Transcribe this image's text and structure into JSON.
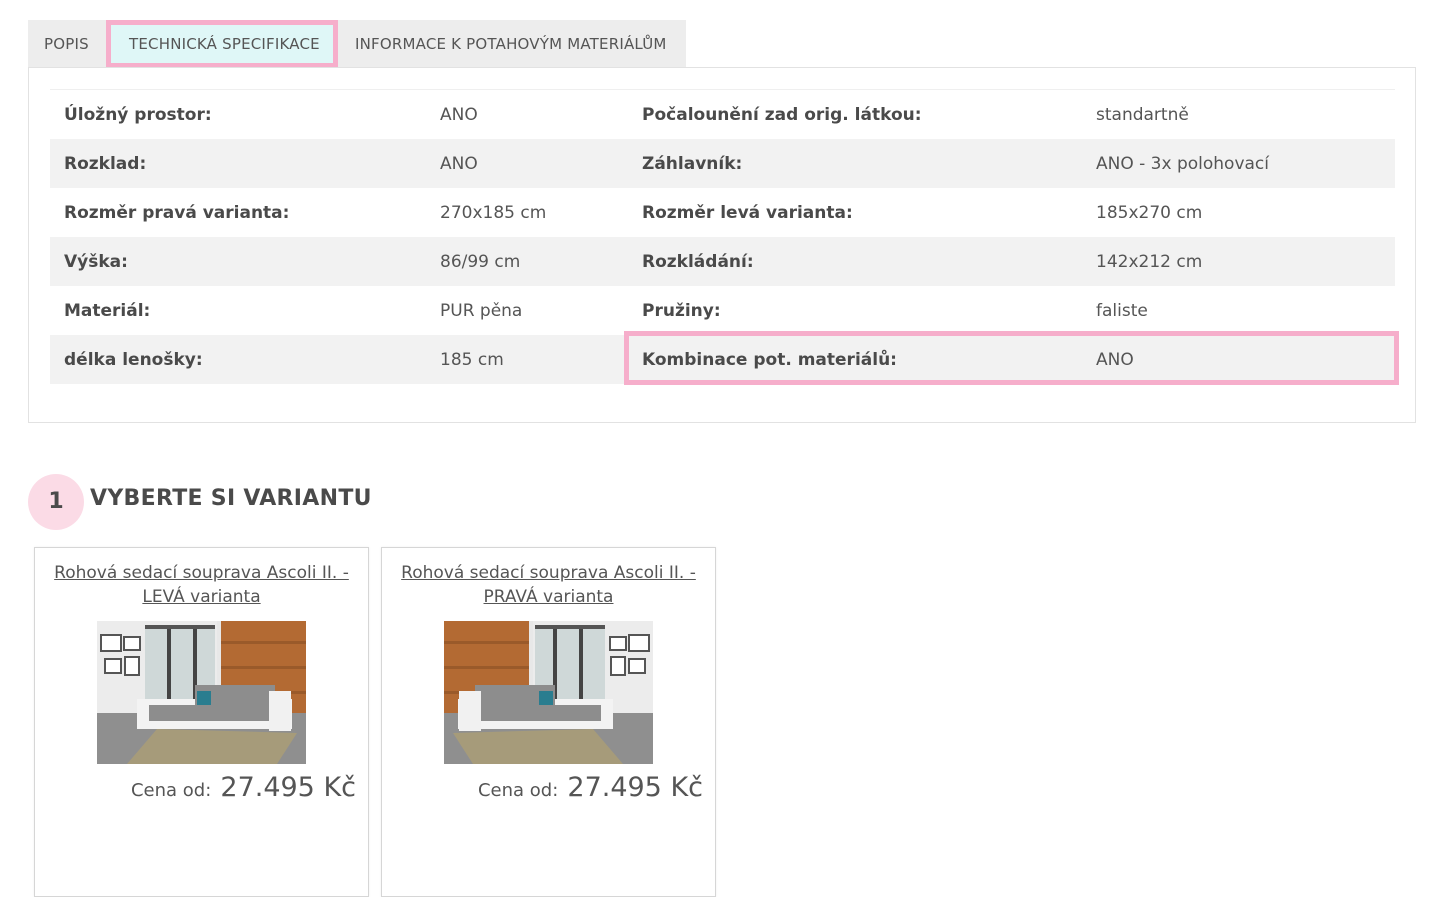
{
  "tabs": [
    {
      "label": "POPIS",
      "active": false
    },
    {
      "label": "TECHNICKÁ SPECIFIKACE",
      "active": true
    },
    {
      "label": "INFORMACE K POTAHOVÝM MATERIÁLŮM",
      "active": false
    }
  ],
  "specs": [
    {
      "k1": "Úložný prostor:",
      "v1": "ANO",
      "k2": "Počalounění zad orig. látkou:",
      "v2": "standartně"
    },
    {
      "k1": "Rozklad:",
      "v1": "ANO",
      "k2": "Záhlavník:",
      "v2": "ANO - 3x polohovací"
    },
    {
      "k1": "Rozměr pravá varianta:",
      "v1": "270x185 cm",
      "k2": "Rozměr levá varianta:",
      "v2": "185x270 cm"
    },
    {
      "k1": "Výška:",
      "v1": "86/99 cm",
      "k2": "Rozkládání:",
      "v2": "142x212 cm"
    },
    {
      "k1": "Materiál:",
      "v1": "PUR pěna",
      "k2": "Pružiny:",
      "v2": "faliste"
    },
    {
      "k1": "délka lenošky:",
      "v1": "185 cm",
      "k2": "Kombinace pot. materiálů:",
      "v2": "ANO"
    }
  ],
  "section": {
    "step": "1",
    "title": "VYBERTE SI VARIANTU"
  },
  "variants": [
    {
      "line1": "Rohová sedací souprava Ascoli II. -",
      "line2": "LEVÁ varianta",
      "price_label": "Cena od:",
      "price": "27.495 Kč",
      "image_icon": "sofa-photo-left"
    },
    {
      "line1": "Rohová sedací souprava Ascoli II. -",
      "line2": "PRAVÁ varianta",
      "price_label": "Cena od:",
      "price": "27.495 Kč",
      "image_icon": "sofa-photo-right"
    }
  ],
  "colors": {
    "highlight": "#f6aecb",
    "active_tab_bg": "#dff7f7",
    "step_circle": "#fbdbe6"
  }
}
